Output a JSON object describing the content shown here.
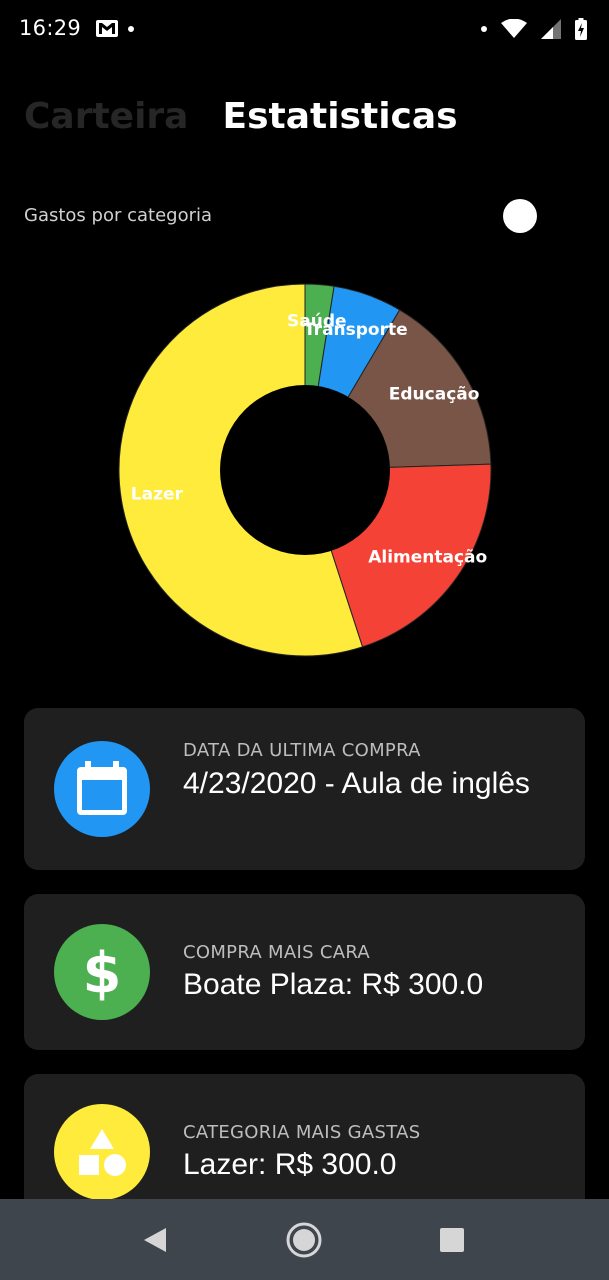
{
  "status_bar": {
    "time": "16:29",
    "left_icons": [
      "gmail-icon",
      "notification-dot-icon"
    ],
    "right_icons": [
      "notification-dot-icon",
      "wifi-icon",
      "signal-icon",
      "battery-charging-icon"
    ]
  },
  "tabs": [
    {
      "label": "Carteira",
      "active": false
    },
    {
      "label": "Estatisticas",
      "active": true
    }
  ],
  "chart_section": {
    "label": "Gastos por categoria",
    "toggle_on": true
  },
  "chart_data": {
    "type": "pie",
    "donut": true,
    "categories": [
      "Saúde",
      "Transporte",
      "Educação",
      "Alimentação",
      "Lazer"
    ],
    "values": [
      2.5,
      6,
      16,
      20.5,
      55
    ],
    "colors": [
      "#4caf50",
      "#2196f3",
      "#795548",
      "#f44336",
      "#ffeb3b"
    ]
  },
  "cards": [
    {
      "caption": "DATA DA ULTIMA COMPRA",
      "value": "4/23/2020 - Aula de inglês",
      "icon": "calendar-icon",
      "color": "#2196f3"
    },
    {
      "caption": "COMPRA MAIS CARA",
      "value": "Boate Plaza: R$ 300.0",
      "icon": "dollar-icon",
      "color": "#4caf50"
    },
    {
      "caption": "CATEGORIA MAIS GASTAS",
      "value": "Lazer: R$ 300.0",
      "icon": "shapes-icon",
      "color": "#ffeb3b"
    }
  ],
  "nav_bar": {
    "buttons": [
      "back-icon",
      "home-icon",
      "recents-icon"
    ],
    "background": "#3f454d"
  }
}
